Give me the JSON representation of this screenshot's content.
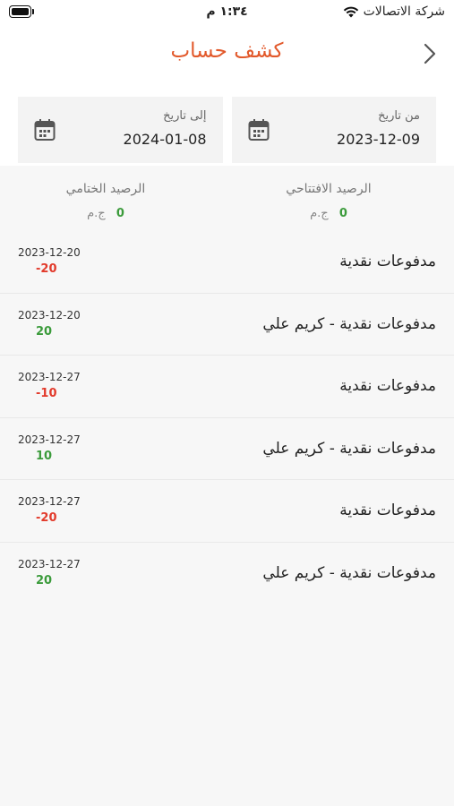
{
  "status_bar": {
    "carrier": "شركة الاتصالات",
    "time": "١:٣٤ م"
  },
  "header": {
    "title": "كشف حساب"
  },
  "filters": {
    "from_label": "من تاريخ",
    "from_value": "2023-12-09",
    "to_label": "إلى تاريخ",
    "to_value": "2024-01-08"
  },
  "balances": {
    "opening_label": "الرصيد الافتتاحي",
    "opening_value": "0",
    "closing_label": "الرصيد الختامي",
    "closing_value": "0",
    "currency": "ج.م"
  },
  "transactions": [
    {
      "description": "مدفوعات نقدية",
      "date": "2023-12-20",
      "amount": "-20",
      "sign": "neg"
    },
    {
      "description": "مدفوعات نقدية - كريم علي",
      "date": "2023-12-20",
      "amount": "20",
      "sign": "pos"
    },
    {
      "description": "مدفوعات نقدية",
      "date": "2023-12-27",
      "amount": "-10",
      "sign": "neg"
    },
    {
      "description": "مدفوعات نقدية - كريم علي",
      "date": "2023-12-27",
      "amount": "10",
      "sign": "pos"
    },
    {
      "description": "مدفوعات نقدية",
      "date": "2023-12-27",
      "amount": "-20",
      "sign": "neg"
    },
    {
      "description": "مدفوعات نقدية - كريم علي",
      "date": "2023-12-27",
      "amount": "20",
      "sign": "pos"
    }
  ],
  "colors": {
    "accent": "#e2592b",
    "positive": "#3b9b3b",
    "negative": "#e23a2b"
  }
}
